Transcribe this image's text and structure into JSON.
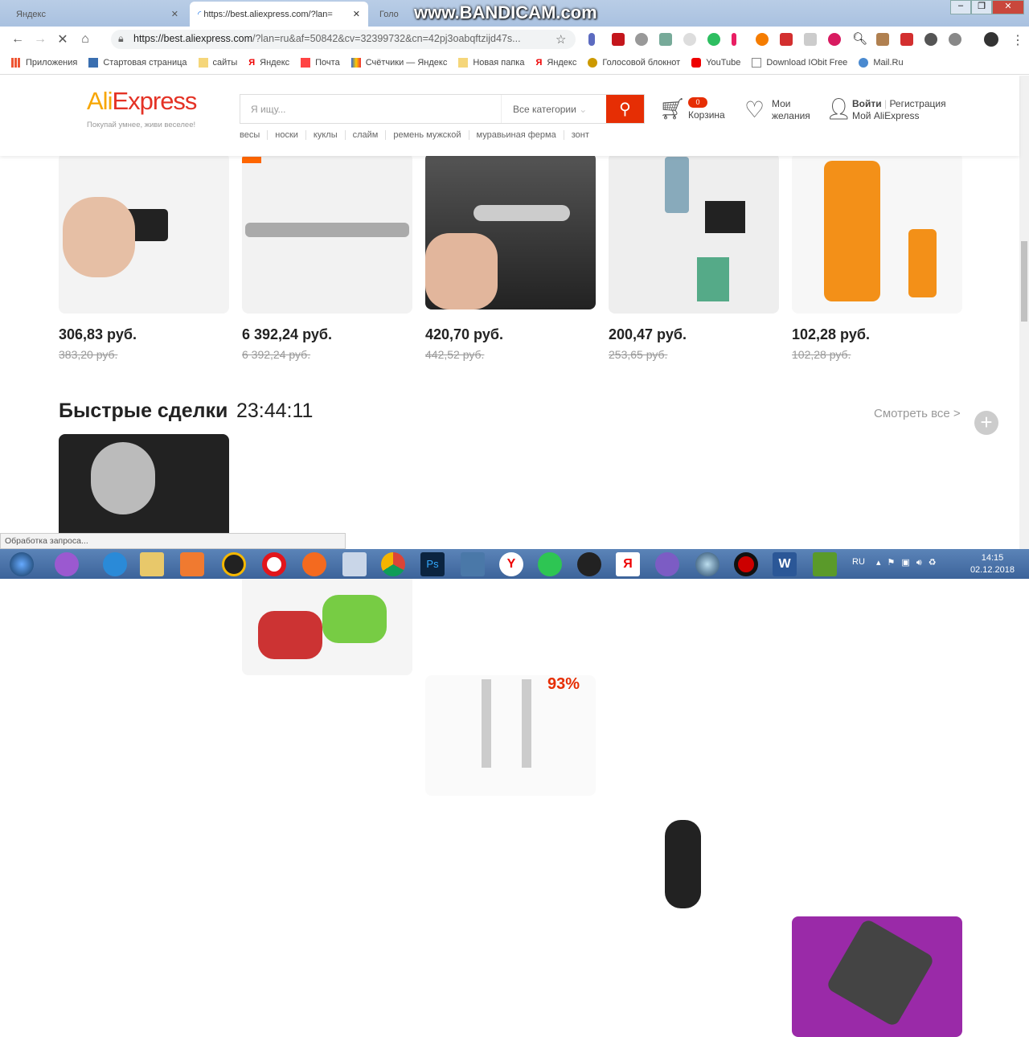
{
  "browser": {
    "tabs": [
      {
        "label": "Яндекс"
      },
      {
        "label": "https://best.aliexpress.com/?lan="
      },
      {
        "label": "Голо"
      }
    ],
    "watermark": "www.BANDICAM.com",
    "url_host": "https://best.aliexpress.com",
    "url_rest": "/?lan=ru&af=50842&cv=32399732&cn=42pj3oabqftzijd47s...",
    "bookmarks": [
      "Приложения",
      "Стартовая страница",
      "сайты",
      "Яндекс",
      "Почта",
      "Счётчики — Яндекс",
      "Новая папка",
      "Яндекс",
      "Голосовой блокнот",
      "YouTube",
      "Download IObit Free",
      "Mail.Ru"
    ],
    "status": "Обработка запроса..."
  },
  "header": {
    "logo": "AliExpress",
    "slogan": "Покупай умнее, живи веселее!",
    "search_placeholder": "Я ищу...",
    "category": "Все категории",
    "hot": [
      "весы",
      "носки",
      "куклы",
      "слайм",
      "ремень мужской",
      "муравьиная ферма",
      "зонт"
    ],
    "cart_count": "0",
    "cart": "Корзина",
    "wish1": "Мои",
    "wish2": "желания",
    "login": "Войти",
    "register": "Регистрация",
    "my": "Мой AliExpress"
  },
  "products": [
    {
      "price": "306,83 руб.",
      "old": "383,20 руб."
    },
    {
      "price": "6 392,24 руб.",
      "old": "6 392,24 руб."
    },
    {
      "price": "420,70 руб.",
      "old": "442,52 руб."
    },
    {
      "price": "200,47 руб.",
      "old": "253,65 руб."
    },
    {
      "price": "102,28 руб.",
      "old": "102,28 руб."
    }
  ],
  "deals": {
    "title": "Быстрые сделки",
    "timer": "23:44:11",
    "see_all": "Смотреть все >",
    "badge": "93%"
  },
  "taskbar": {
    "lang": "RU",
    "time": "14:15",
    "date": "02.12.2018"
  },
  "colors": {
    "accent": "#e62e04"
  }
}
